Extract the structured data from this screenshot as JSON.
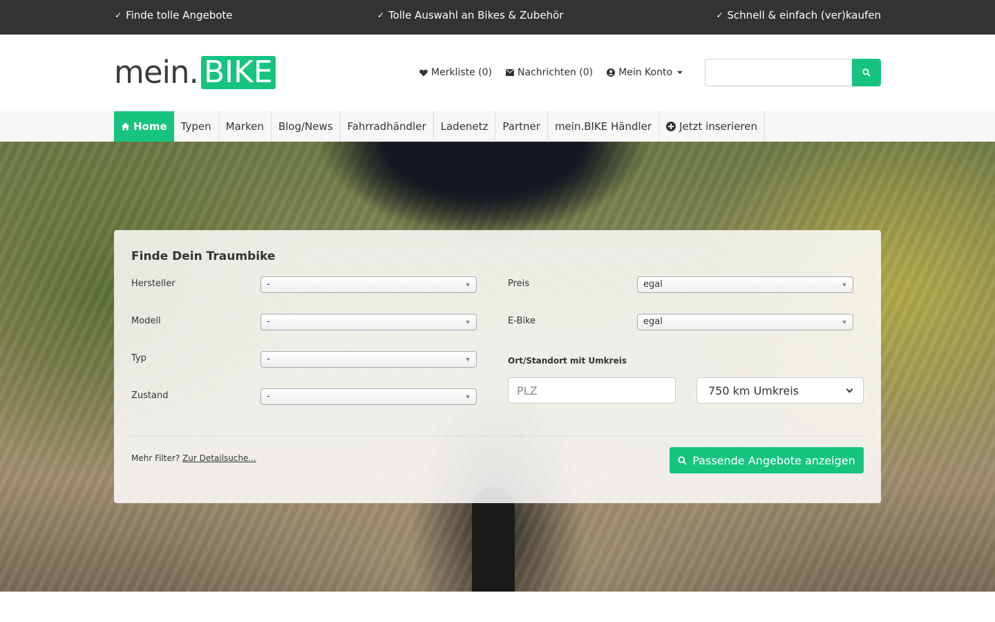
{
  "topbar": {
    "usps": [
      "Finde tolle Angebote",
      "Tolle Auswahl an Bikes & Zubehör",
      "Schnell & einfach (ver)kaufen"
    ]
  },
  "header": {
    "logo_text": "mein.",
    "logo_box": "BIKE",
    "links": {
      "wishlist": "Merkliste (0)",
      "messages": "Nachrichten (0)",
      "account": "Mein Konto"
    },
    "search": {
      "placeholder": ""
    }
  },
  "nav": {
    "items": [
      "Home",
      "Typen",
      "Marken",
      "Blog/News",
      "Fahrradhändler",
      "Ladenetz",
      "Partner",
      "mein.BIKE Händler",
      "Jetzt inserieren"
    ]
  },
  "search_panel": {
    "title": "Finde Dein Traumbike",
    "fields": {
      "hersteller": {
        "label": "Hersteller",
        "value": "-"
      },
      "modell": {
        "label": "Modell",
        "value": "-"
      },
      "typ": {
        "label": "Typ",
        "value": "-"
      },
      "zustand": {
        "label": "Zustand",
        "value": "-"
      },
      "preis": {
        "label": "Preis",
        "value": "egal"
      },
      "ebike": {
        "label": "E-Bike",
        "value": "egal"
      }
    },
    "location_label": "Ort/Standort mit Umkreis",
    "plz_placeholder": "PLZ",
    "radius_value": "750 km Umkreis",
    "more_filter_text": "Mehr Filter?",
    "detail_link": "Zur Detailsuche...",
    "submit_label": "Passende Angebote anzeigen"
  },
  "colors": {
    "accent": "#16c47f",
    "topbar": "#333333"
  }
}
